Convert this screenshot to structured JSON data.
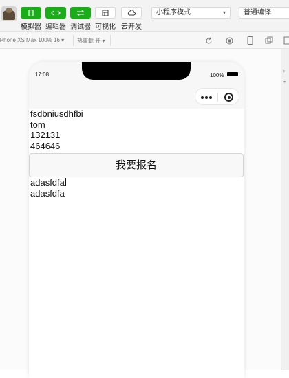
{
  "toolbar": {
    "buttons": [
      {
        "label": "模拟器",
        "icon": "phone-icon"
      },
      {
        "label": "编辑器",
        "icon": "code-icon"
      },
      {
        "label": "调试器",
        "icon": "debug-icon"
      },
      {
        "label": "可视化",
        "icon": "grid-icon"
      },
      {
        "label": "云开发",
        "icon": "cloud-icon"
      }
    ],
    "mode_select": "小程序模式",
    "compile_select": "普通编译",
    "accent": "#1aad19"
  },
  "subbar": {
    "device": "iPhone XS Max 100% 16 ▾",
    "hot_reload": "热重载 开 ▾"
  },
  "phone": {
    "status": {
      "time": "17:08",
      "battery": "100%"
    }
  },
  "page": {
    "lines_top": [
      "fsdbniusdhfbi",
      "tom",
      "132131",
      "464646"
    ],
    "signup_button": "我要报名",
    "lines_bottom": [
      "adasfdfa",
      "adasfdfa"
    ]
  }
}
